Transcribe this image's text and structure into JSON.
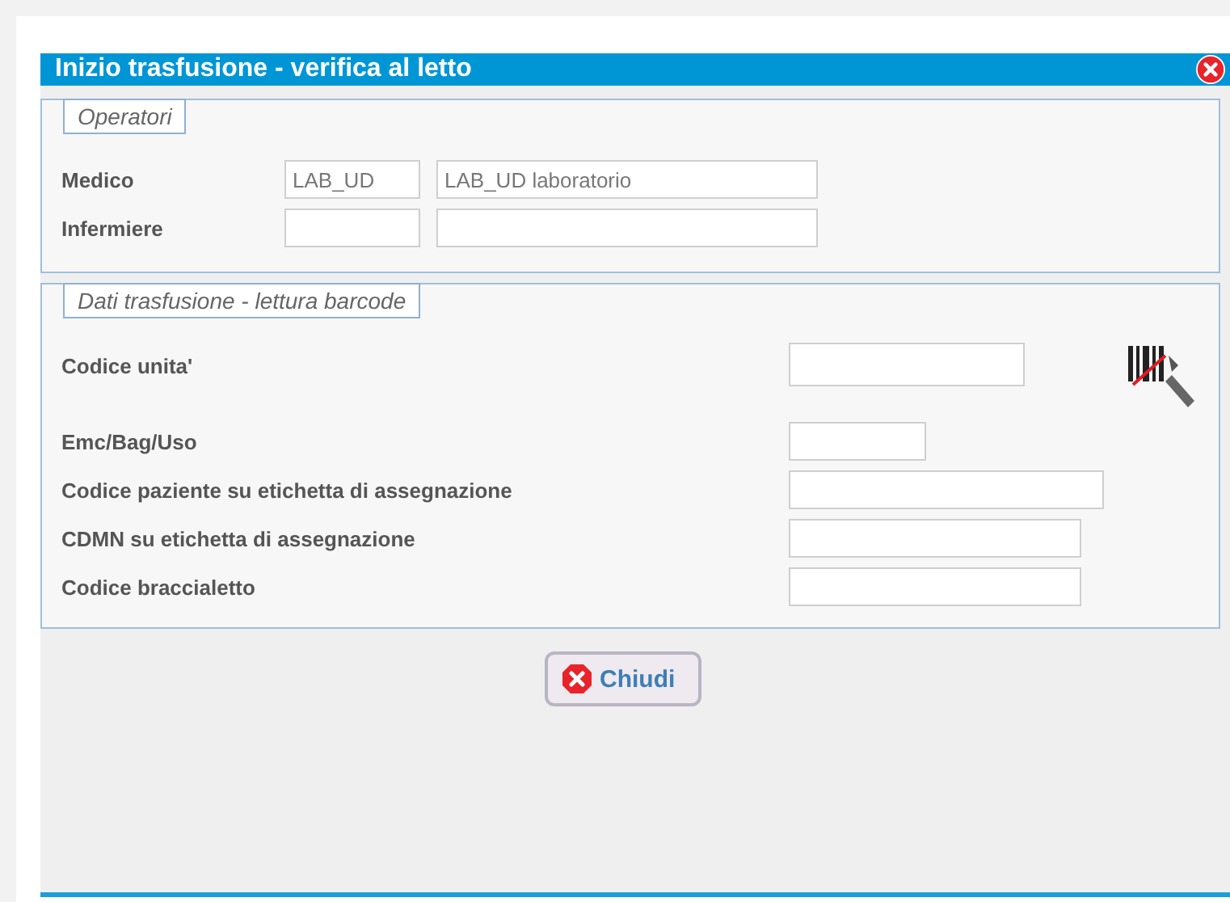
{
  "dialog": {
    "title": "Inizio trasfusione - verifica al letto"
  },
  "operatori": {
    "legend": "Operatori",
    "rows": [
      {
        "label": "Medico",
        "code": "LAB_UD",
        "name": "LAB_UD laboratorio"
      },
      {
        "label": "Infermiere",
        "code": "",
        "name": ""
      }
    ]
  },
  "trasfusione": {
    "legend": "Dati trasfusione - lettura barcode",
    "rows": [
      {
        "label": "Codice unita'",
        "scanner": true
      },
      {
        "label": "Emc/Bag/Uso",
        "scanner": false
      },
      {
        "label": "Codice paziente su etichetta di assegnazione",
        "scanner": false
      },
      {
        "label": "CDMN su etichetta di assegnazione",
        "scanner": false
      },
      {
        "label": "Codice braccialetto",
        "scanner": false
      }
    ]
  },
  "buttons": [
    {
      "label": "Chiudi"
    }
  ]
}
